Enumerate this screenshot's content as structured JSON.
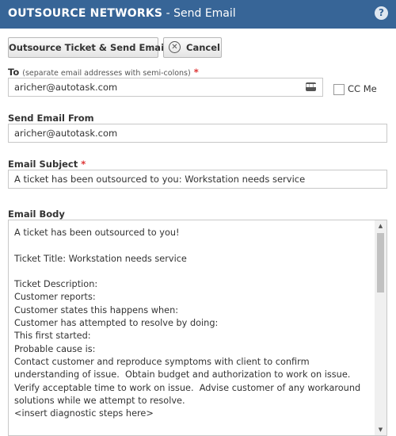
{
  "header": {
    "company": "OUTSOURCE NETWORKS",
    "separator": " - ",
    "title": "Send Email",
    "help_icon": "?"
  },
  "toolbar": {
    "primary_label": "Outsource Ticket & Send Email",
    "cancel_label": "Cancel",
    "cancel_icon": "✕"
  },
  "to": {
    "label": "To",
    "hint": "(separate email addresses with semi-colons)",
    "required_mark": "*",
    "value": "aricher@autotask.com",
    "picker_icon": "▪▪▪"
  },
  "cc_me": {
    "label": "CC Me",
    "checked": false
  },
  "from": {
    "label": "Send Email From",
    "value": "aricher@autotask.com"
  },
  "subject": {
    "label": "Email Subject",
    "required_mark": "*",
    "value": "A ticket has been outsourced to you: Workstation needs service"
  },
  "body": {
    "label": "Email Body",
    "text": "A ticket has been outsourced to you!\n\nTicket Title: Workstation needs service\n\nTicket Description:\nCustomer reports:\nCustomer states this happens when:\nCustomer has attempted to resolve by doing:\nThis first started:\nProbable cause is:\nContact customer and reproduce symptoms with client to confirm understanding of issue.  Obtain budget and authorization to work on issue.  Verify acceptable time to work on issue.  Advise customer of any workaround solutions while we attempt to resolve.\n<insert diagnostic steps here>\n\nIf upgrades or further work outside of approved budget is needed review with"
  },
  "colors": {
    "header_bg": "#376597",
    "required": "#d33333"
  }
}
